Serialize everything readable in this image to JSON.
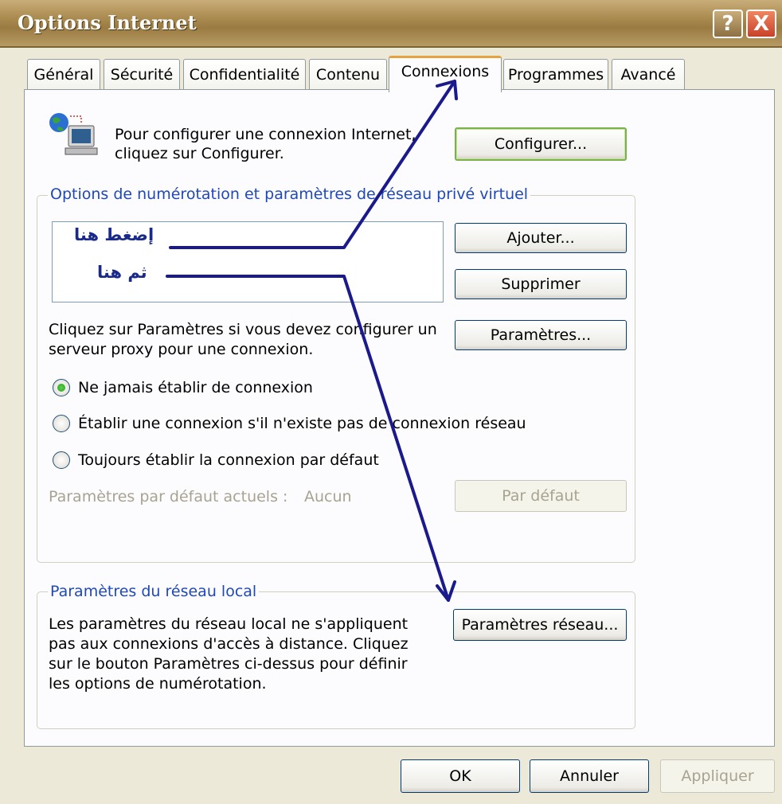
{
  "window": {
    "title": "Options Internet"
  },
  "title_buttons": {
    "help": "?",
    "close": "X"
  },
  "tabs": [
    {
      "label": "Général"
    },
    {
      "label": "Sécurité"
    },
    {
      "label": "Confidentialité"
    },
    {
      "label": "Contenu"
    },
    {
      "label": "Connexions",
      "active": true
    },
    {
      "label": "Programmes"
    },
    {
      "label": "Avancé"
    }
  ],
  "setup": {
    "text_line1": "Pour configurer une connexion Internet,",
    "text_line2": "cliquez sur Configurer.",
    "button": "Configurer..."
  },
  "dialup": {
    "legend": "Options de numérotation et paramètres de réseau privé virtuel",
    "add_button": "Ajouter...",
    "remove_button": "Supprimer",
    "proxy_text_line1": "Cliquez sur Paramètres si vous devez configurer un",
    "proxy_text_line2": "serveur proxy pour une connexion.",
    "settings_button": "Paramètres...",
    "radio_options": [
      {
        "label": "Ne jamais établir de connexion",
        "selected": true
      },
      {
        "label": "Établir une connexion s'il n'existe pas de connexion réseau",
        "selected": false
      },
      {
        "label": "Toujours établir la connexion par défaut",
        "selected": false
      }
    ],
    "current_default_label": "Paramètres par défaut actuels :",
    "current_default_value": "Aucun",
    "default_button": "Par défaut"
  },
  "lan": {
    "legend": "Paramètres du réseau local",
    "text_lines": [
      "Les paramètres du réseau local ne s'appliquent",
      "pas aux connexions d'accès à distance. Cliquez",
      "sur le bouton Paramètres ci-dessus pour définir",
      "les options de numérotation."
    ],
    "button": "Paramètres réseau..."
  },
  "footer": {
    "ok": "OK",
    "cancel": "Annuler",
    "apply": "Appliquer"
  },
  "annotations": {
    "first": "إضغط هنا",
    "second": "ثم هنا",
    "arrow_color": "#1a1a8c"
  },
  "icons": {
    "network": "network-computer-icon"
  }
}
